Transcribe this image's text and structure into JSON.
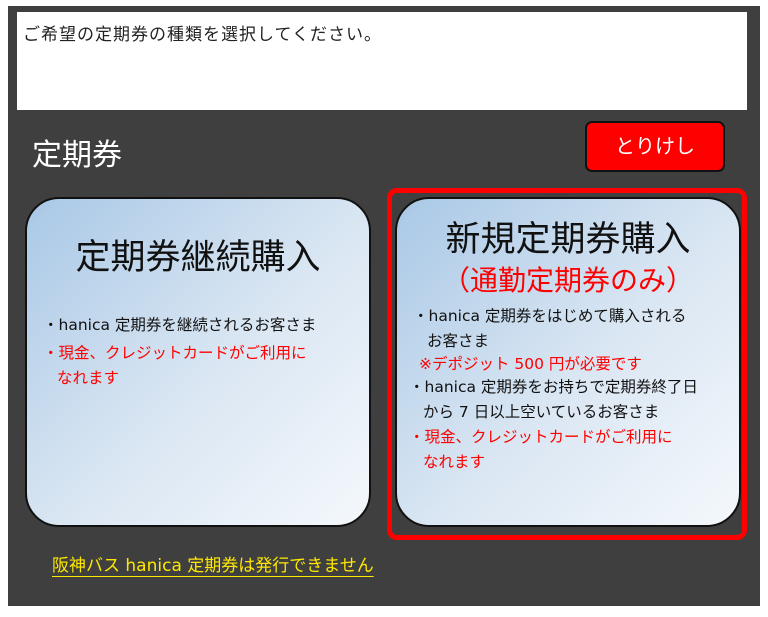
{
  "instruction": "ご希望の定期券の種類を選択してください。",
  "page_title": "定期券",
  "cancel_button": "とりけし",
  "card_continue": {
    "title": "定期券継続購入",
    "line1": "・hanica 定期券を継続されるお客さま",
    "line2a": "・現金、クレジットカードがご利用に",
    "line2b": "なれます"
  },
  "card_new": {
    "title": "新規定期券購入",
    "subtitle": "（通勤定期券のみ）",
    "line1a": "・hanica 定期券をはじめて購入される",
    "line1b": "お客さま",
    "deposit_note": "※デポジット 500 円が必要です",
    "line2a": "・hanica 定期券をお持ちで定期券終了日",
    "line2b": "から 7 日以上空いているお客さま",
    "line3a": "・現金、クレジットカードがご利用に",
    "line3b": "なれます"
  },
  "hanshin_notice": "阪神バス hanica 定期券は発行できません",
  "colors": {
    "background": "#3f3f3f",
    "accent_red": "#ff0000",
    "notice_yellow": "#ffe800",
    "card_gradient_start": "#a9c8e6"
  }
}
